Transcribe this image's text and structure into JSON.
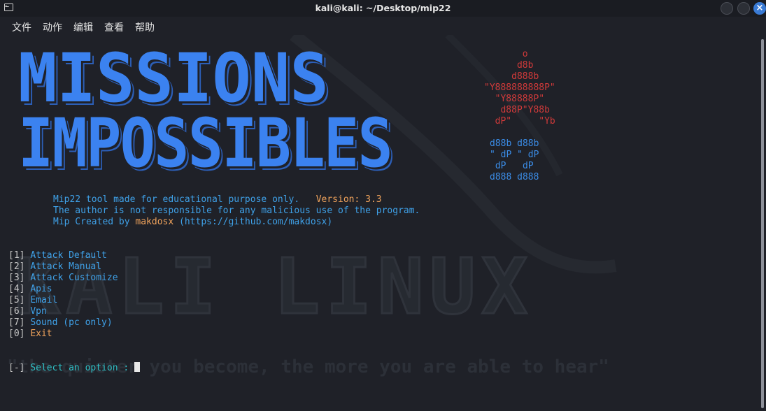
{
  "window": {
    "title": "kali@kali: ~/Desktop/mip22"
  },
  "menubar": {
    "items": [
      "文件",
      "动作",
      "编辑",
      "查看",
      "帮助"
    ]
  },
  "banner": {
    "line1": "MISSIONS",
    "line2": "IMPOSSIBLES",
    "color": "#3b82f0"
  },
  "ascii_art": {
    "red": "       o\n      d8b\n     d888b\n\"Y888888888P\"\n  \"Y88888P\"\n   d88P\"Y88b\n  dP\"     \"Yb",
    "blue": "d88b d88b\n\" dP \" dP\n dP   dP\nd888 d888"
  },
  "info": {
    "line1": "Mip22 tool made for educational purpose only.",
    "version": "Version: 3.3",
    "line2": "The author is not responsible for any malicious use of the program.",
    "line3_prefix": "Mip Created by ",
    "author": "makdosx",
    "line3_suffix": " (https://github.com/makdosx)"
  },
  "menu_options": [
    {
      "key": "[1]",
      "label": "Attack Default"
    },
    {
      "key": "[2]",
      "label": "Attack Manual"
    },
    {
      "key": "[3]",
      "label": "Attack Customize"
    },
    {
      "key": "[4]",
      "label": "Apis"
    },
    {
      "key": "[5]",
      "label": "Email"
    },
    {
      "key": "[6]",
      "label": "Vpn"
    },
    {
      "key": "[7]",
      "label": "Sound (pc only)"
    },
    {
      "key": "[0]",
      "label": "Exit"
    }
  ],
  "prompt": {
    "bracket": "[-]",
    "text": " Select an option : "
  },
  "watermark": {
    "logo": "KALI LINUX",
    "quote": "\"the quieter you become, the more you are able to hear\""
  }
}
